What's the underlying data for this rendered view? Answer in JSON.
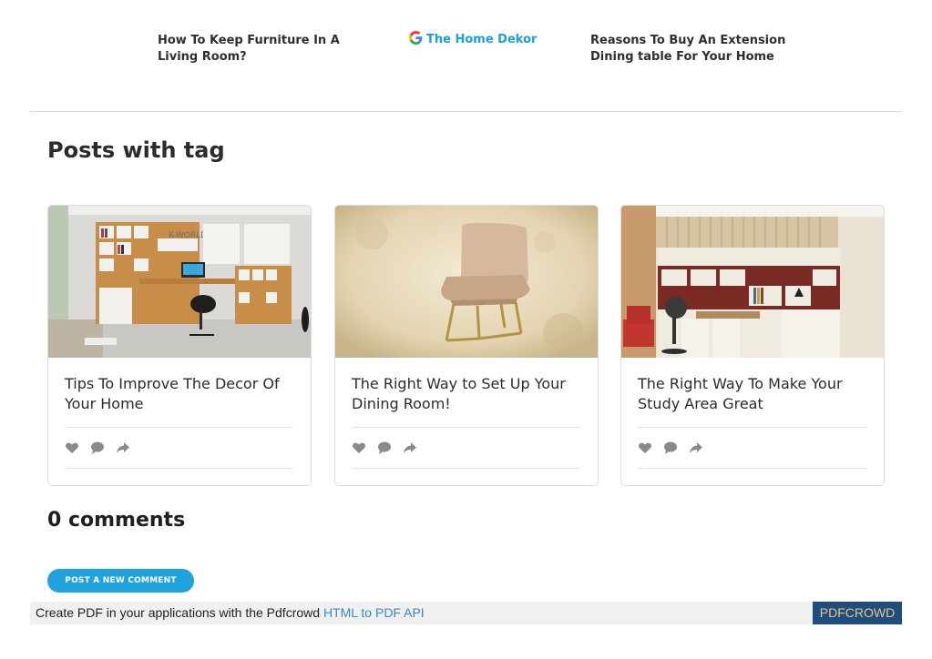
{
  "navigation": {
    "prev_post": "How To Keep Furniture In A Living Room?",
    "brand": {
      "name": "The Home Dekor",
      "icon": "google-g-icon"
    },
    "next_post": "Reasons To Buy An Extension Dining table For Your Home"
  },
  "section": {
    "title": "Posts with tag"
  },
  "cards": [
    {
      "title": "Tips To Improve The Decor Of Your Home",
      "image_label": "K-WORLD",
      "image": "home-office-shelving-photo"
    },
    {
      "title": "The Right Way to Set Up Your Dining Room!",
      "image": "dining-chair-photo"
    },
    {
      "title": "The Right Way To Make Your Study Area Great",
      "image": "study-room-cabinets-photo"
    }
  ],
  "card_actions": [
    "heart-icon",
    "comment-icon",
    "share-icon"
  ],
  "comments": {
    "title": "0 comments",
    "button_label": "POST A NEW COMMENT"
  },
  "pdf_bar": {
    "text": "Create PDF in your applications with the Pdfcrowd ",
    "link": "HTML to PDF API",
    "badge": "PDFCROWD"
  },
  "colors": {
    "accent": "#1fa3dd",
    "brand_text": "#1a9fd6",
    "pdf_badge_bg": "#1e4e80",
    "pdf_badge_text": "#e8c47c"
  }
}
